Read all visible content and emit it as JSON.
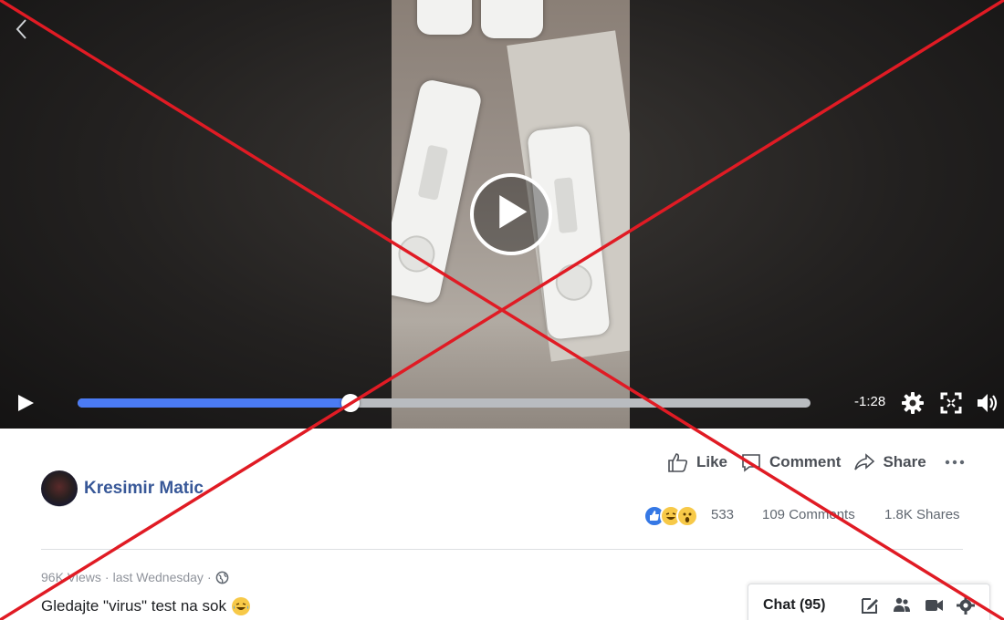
{
  "video": {
    "time_remaining": "-1:28",
    "progress": 0.372,
    "icons": [
      "back-chevron-icon",
      "play-circle-icon",
      "play-icon",
      "gear-icon",
      "fullscreen-icon",
      "volume-icon"
    ]
  },
  "post": {
    "actions": {
      "like": "Like",
      "comment": "Comment",
      "share": "Share"
    },
    "author": "Kresimir Matic",
    "reaction_count": "533",
    "comments": "109 Comments",
    "shares": "1.8K Shares",
    "views": "96K Views",
    "separator": "·",
    "posted": "last Wednesday",
    "caption": "Gledajte \"virus\" test na sok"
  },
  "chat": {
    "label": "Chat (95)"
  },
  "colors": {
    "accent": "#4b7bf4",
    "link": "#385898",
    "cross": "#e01b24"
  }
}
